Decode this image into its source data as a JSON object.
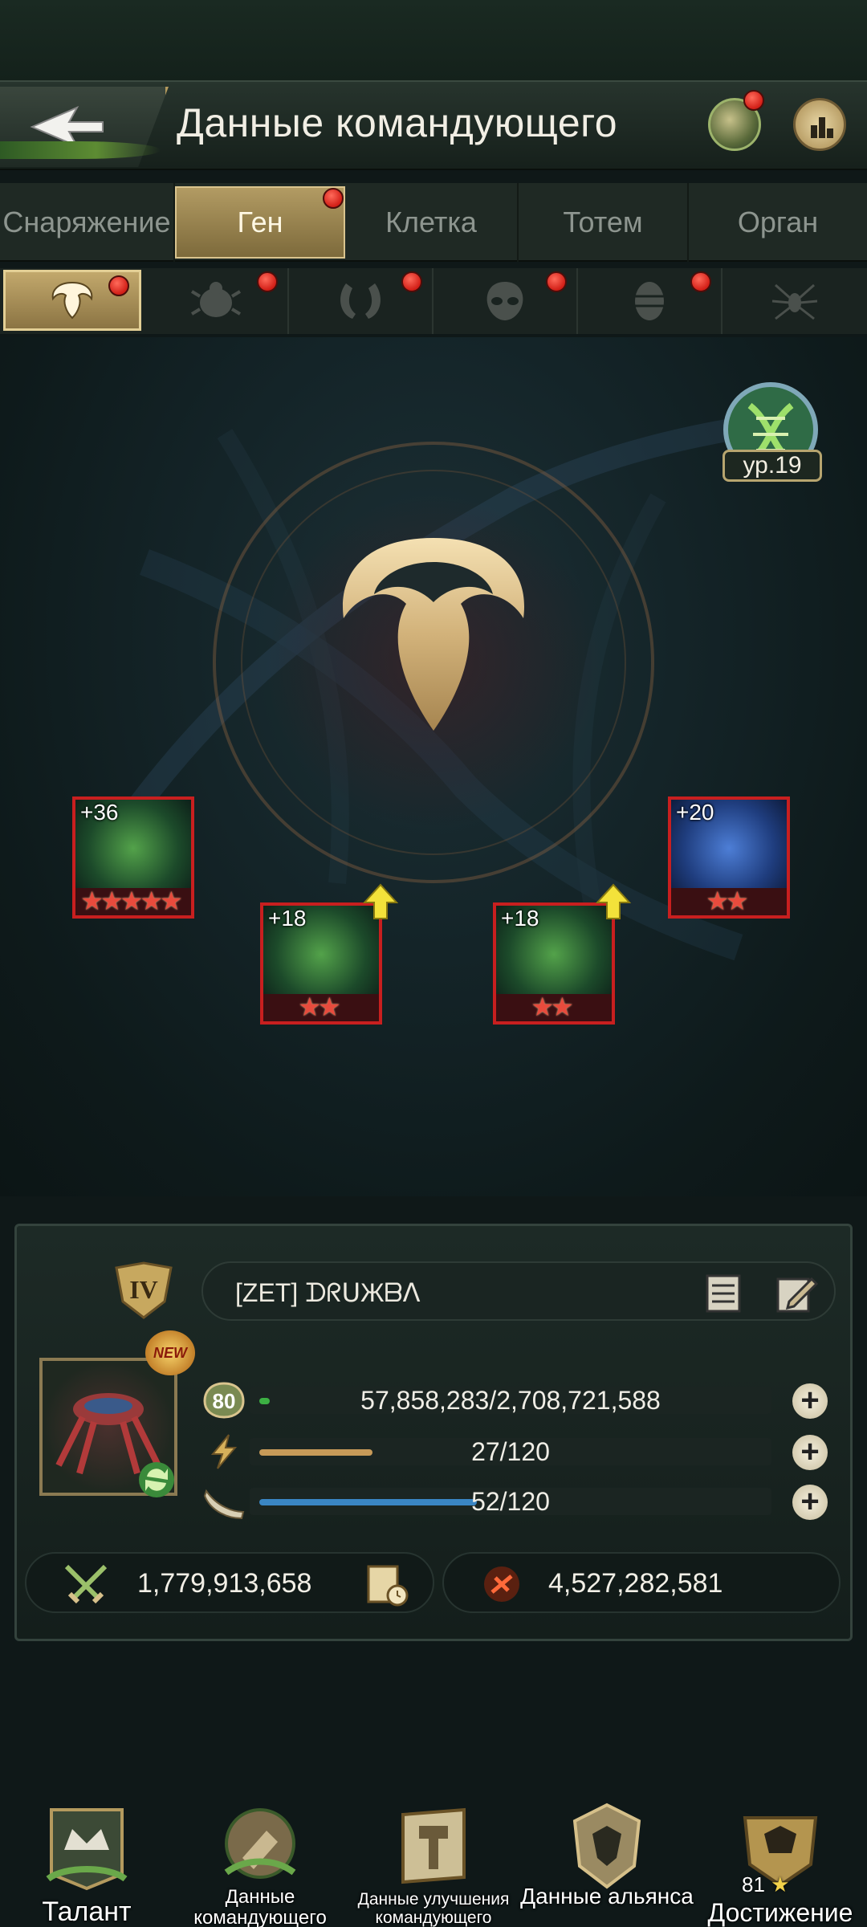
{
  "header": {
    "title": "Данные командующего",
    "back_icon": "back-arrow-icon",
    "stats_icon": "bar-chart-icon"
  },
  "tabs": [
    {
      "label": "Снаряжение",
      "active": false
    },
    {
      "label": "Ген",
      "active": true,
      "badge": true
    },
    {
      "label": "Клетка",
      "active": false
    },
    {
      "label": "Тотем",
      "active": false
    },
    {
      "label": "Орган",
      "active": false
    }
  ],
  "subtabs": [
    {
      "icon": "horned-mask-icon",
      "active": true,
      "badge": true
    },
    {
      "icon": "beetle-icon",
      "active": false,
      "badge": true
    },
    {
      "icon": "mandible-icon",
      "active": false,
      "badge": true
    },
    {
      "icon": "skull-mask-icon",
      "active": false,
      "badge": true
    },
    {
      "icon": "cocoon-icon",
      "active": false,
      "badge": true
    },
    {
      "icon": "spider-icon",
      "active": false,
      "badge": false
    }
  ],
  "gene": {
    "level_label": "ур.19",
    "cards": [
      {
        "bonus": "+36",
        "stars": 5,
        "color": "green",
        "upgrade": false
      },
      {
        "bonus": "+18",
        "stars": 2,
        "color": "green",
        "upgrade": true
      },
      {
        "bonus": "+18",
        "stars": 2,
        "color": "green",
        "upgrade": true
      },
      {
        "bonus": "+20",
        "stars": 2,
        "color": "blue",
        "upgrade": false
      }
    ]
  },
  "player": {
    "rank": "IV",
    "name": "[ZET]  ᗪᖇᑌЖᗷᐱ",
    "new_badge": "NEW",
    "level": "80",
    "exp": "57,858,283/2,708,721,588",
    "exp_fraction": 0.021,
    "energy": "27/120",
    "energy_fraction": 0.225,
    "stamina": "52/120",
    "stamina_fraction": 0.433,
    "power": "1,779,913,658",
    "kills": "4,527,282,581"
  },
  "nav": [
    {
      "label": "Талант",
      "icon": "talent-crown-icon"
    },
    {
      "label": "Данные командующего",
      "icon": "commander-data-icon"
    },
    {
      "label": "Данные улучшения командующего",
      "icon": "hammer-scroll-icon"
    },
    {
      "label": "Данные альянса",
      "icon": "alliance-shield-icon"
    },
    {
      "label": "Достижение",
      "icon": "achievement-trophy-icon",
      "badge": "81"
    }
  ],
  "colors": {
    "accent_gold": "#c2a86c",
    "badge_red": "#d21f17",
    "card_border": "#c81f1f",
    "exp_bar": "#3cb043",
    "energy_bar": "#c79a58",
    "stamina_bar": "#3a86c4"
  }
}
